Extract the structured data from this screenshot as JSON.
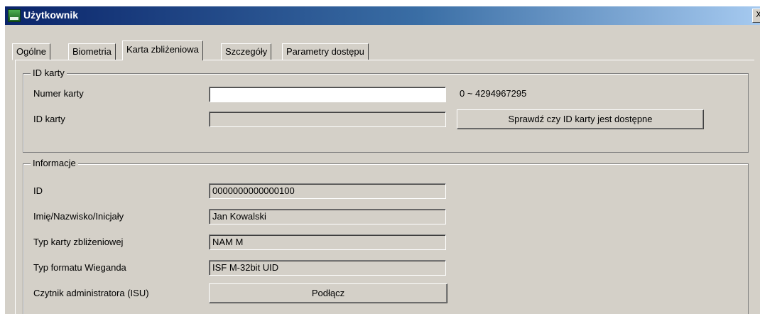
{
  "window": {
    "title": "Użytkownik",
    "close_glyph": "X"
  },
  "tabs": [
    {
      "label": "Ogólne"
    },
    {
      "label": "Biometria"
    },
    {
      "label": "Karta zbliżeniowa"
    },
    {
      "label": "Szczegóły"
    },
    {
      "label": "Parametry dostępu"
    }
  ],
  "active_tab": "Karta zbliżeniowa",
  "card_id": {
    "legend": "ID karty",
    "card_number_label": "Numer karty",
    "card_number_value": "",
    "card_number_range": "0 ~ 4294967295",
    "card_id_label": "ID karty",
    "card_id_value": "",
    "check_button": "Sprawdź czy ID karty jest dostępne"
  },
  "info": {
    "legend": "Informacje",
    "id_label": "ID",
    "id_value": "0000000000000100",
    "name_label": "Imię/Nazwisko/Inicjały",
    "name_value": "Jan Kowalski",
    "card_type_label": "Typ karty zbliżeniowej",
    "card_type_value": "NAM M",
    "wiegand_label": "Typ formatu Wieganda",
    "wiegand_value": "ISF M-32bit UID",
    "admin_reader_label": "Czytnik administratora (ISU)",
    "connect_button": "Podłącz"
  },
  "colors": {
    "window_bg": "#d4d0c8",
    "titlebar_start": "#0a246a",
    "titlebar_end": "#a6caf0"
  }
}
